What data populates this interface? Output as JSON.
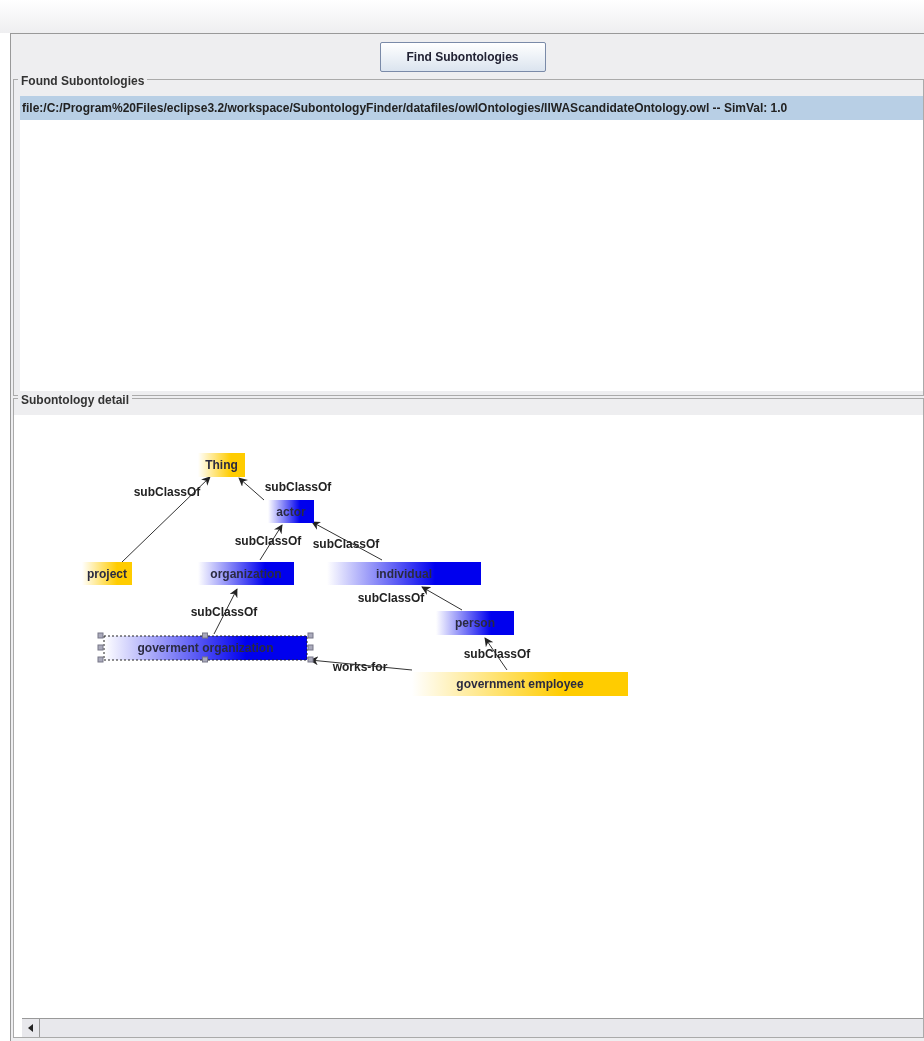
{
  "toolbar": {
    "button": "Find Subontologies"
  },
  "found_subontologies": {
    "title": "Found Subontologies",
    "items": [
      {
        "text": "file:/C:/Program%20Files/eclipse3.2/workspace/SubontologyFinder/datafiles/owlOntologies/IIWAScandidateOntology.owl -- SimVal: 1.0",
        "selected": true
      }
    ]
  },
  "subontology_detail": {
    "title": "Subontology detail",
    "nodes": [
      {
        "label": "Thing",
        "color": "#ffcc00",
        "selected": false
      },
      {
        "label": "actor",
        "color": "#0000ee",
        "selected": false
      },
      {
        "label": "project",
        "color": "#ffcc00",
        "selected": false
      },
      {
        "label": "organization",
        "color": "#0000ee",
        "selected": false
      },
      {
        "label": "individual",
        "color": "#0000ee",
        "selected": false
      },
      {
        "label": "person",
        "color": "#0000ee",
        "selected": false
      },
      {
        "label": "goverment organization",
        "color": "#0000ee",
        "selected": true
      },
      {
        "label": "government employee",
        "color": "#ffcc00",
        "selected": false
      }
    ],
    "edges": [
      {
        "label": "subClassOf"
      },
      {
        "label": "subClassOf"
      },
      {
        "label": "subClassOf"
      },
      {
        "label": "subClassOf"
      },
      {
        "label": "subClassOf"
      },
      {
        "label": "subClassOf"
      },
      {
        "label": "subClassOf"
      },
      {
        "label": "works-for"
      }
    ]
  }
}
